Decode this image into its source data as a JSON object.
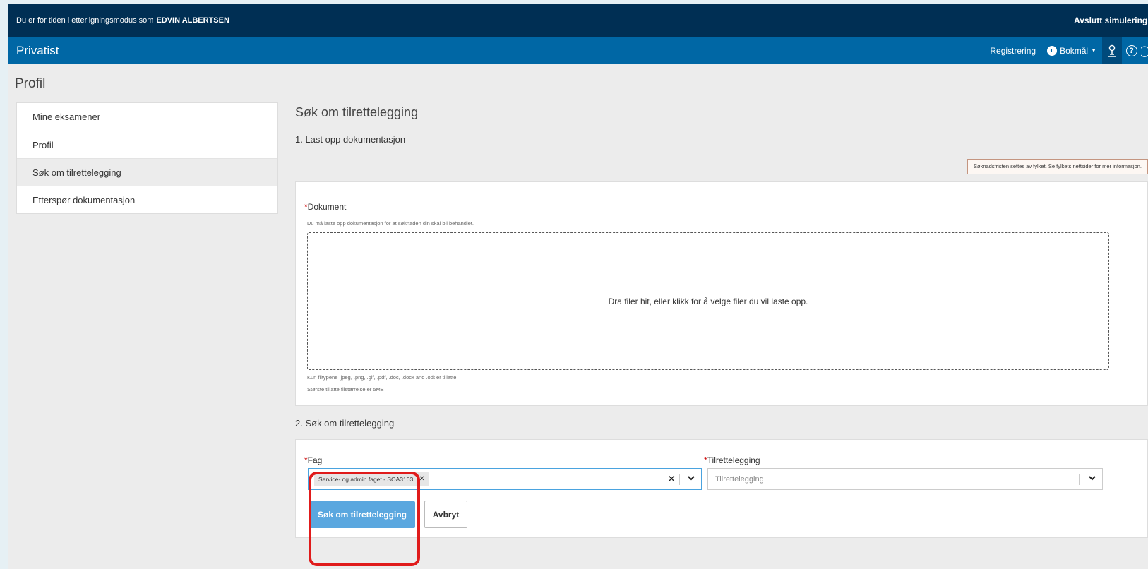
{
  "simulation": {
    "prefix": "Du er for tiden i etterligningsmodus som",
    "name": "EDVIN ALBERTSEN",
    "exit_label": "Avslutt simulering"
  },
  "nav": {
    "brand": "Privatist",
    "registration": "Registrering",
    "language": "Bokmål",
    "help_glyph": "?"
  },
  "page_title": "Profil",
  "sidebar": {
    "items": [
      {
        "label": "Mine eksamener"
      },
      {
        "label": "Profil"
      },
      {
        "label": "Søk om tilrettelegging"
      },
      {
        "label": "Etterspør dokumentasjon"
      }
    ],
    "active_index": 2
  },
  "main": {
    "heading": "Søk om tilrettelegging",
    "step1": "1. Last opp dokumentasjon",
    "notice": "Søknadsfristen settes av fylket. Se fylkets nettsider for mer informasjon.",
    "document": {
      "required_mark": "*",
      "label": "Dokument",
      "help": "Du må laste opp dokumentasjon for at søknaden din skal bli behandlet.",
      "dropzone_text": "Dra filer hit, eller klikk for å velge filer du vil laste opp.",
      "filetypes": "Kun filtypene .jpeg, .png, .gif, .pdf, .doc, .docx and .odt er tillatte",
      "filesize": "Største tillatte filstørrelse er 5MB"
    },
    "step2": "2. Søk om tilrettelegging",
    "fag": {
      "required_mark": "*",
      "label": "Fag",
      "selected_chip": "Service- og admin.faget - SOA3103"
    },
    "tilrettelegging": {
      "required_mark": "*",
      "label": "Tilrettelegging",
      "placeholder": "Tilrettelegging"
    },
    "submit_label": "Søk om tilrettelegging",
    "cancel_label": "Avbryt"
  },
  "icons": {
    "globe": "globe-icon",
    "user": "user-icon",
    "help": "help-icon",
    "clear": "clear-icon",
    "chevron": "chevron-down-icon"
  },
  "colors": {
    "sim_bar": "#002f54",
    "nav_bar": "#0067a5",
    "primary_button": "#5aa7df",
    "highlight": "#e01b1b"
  }
}
